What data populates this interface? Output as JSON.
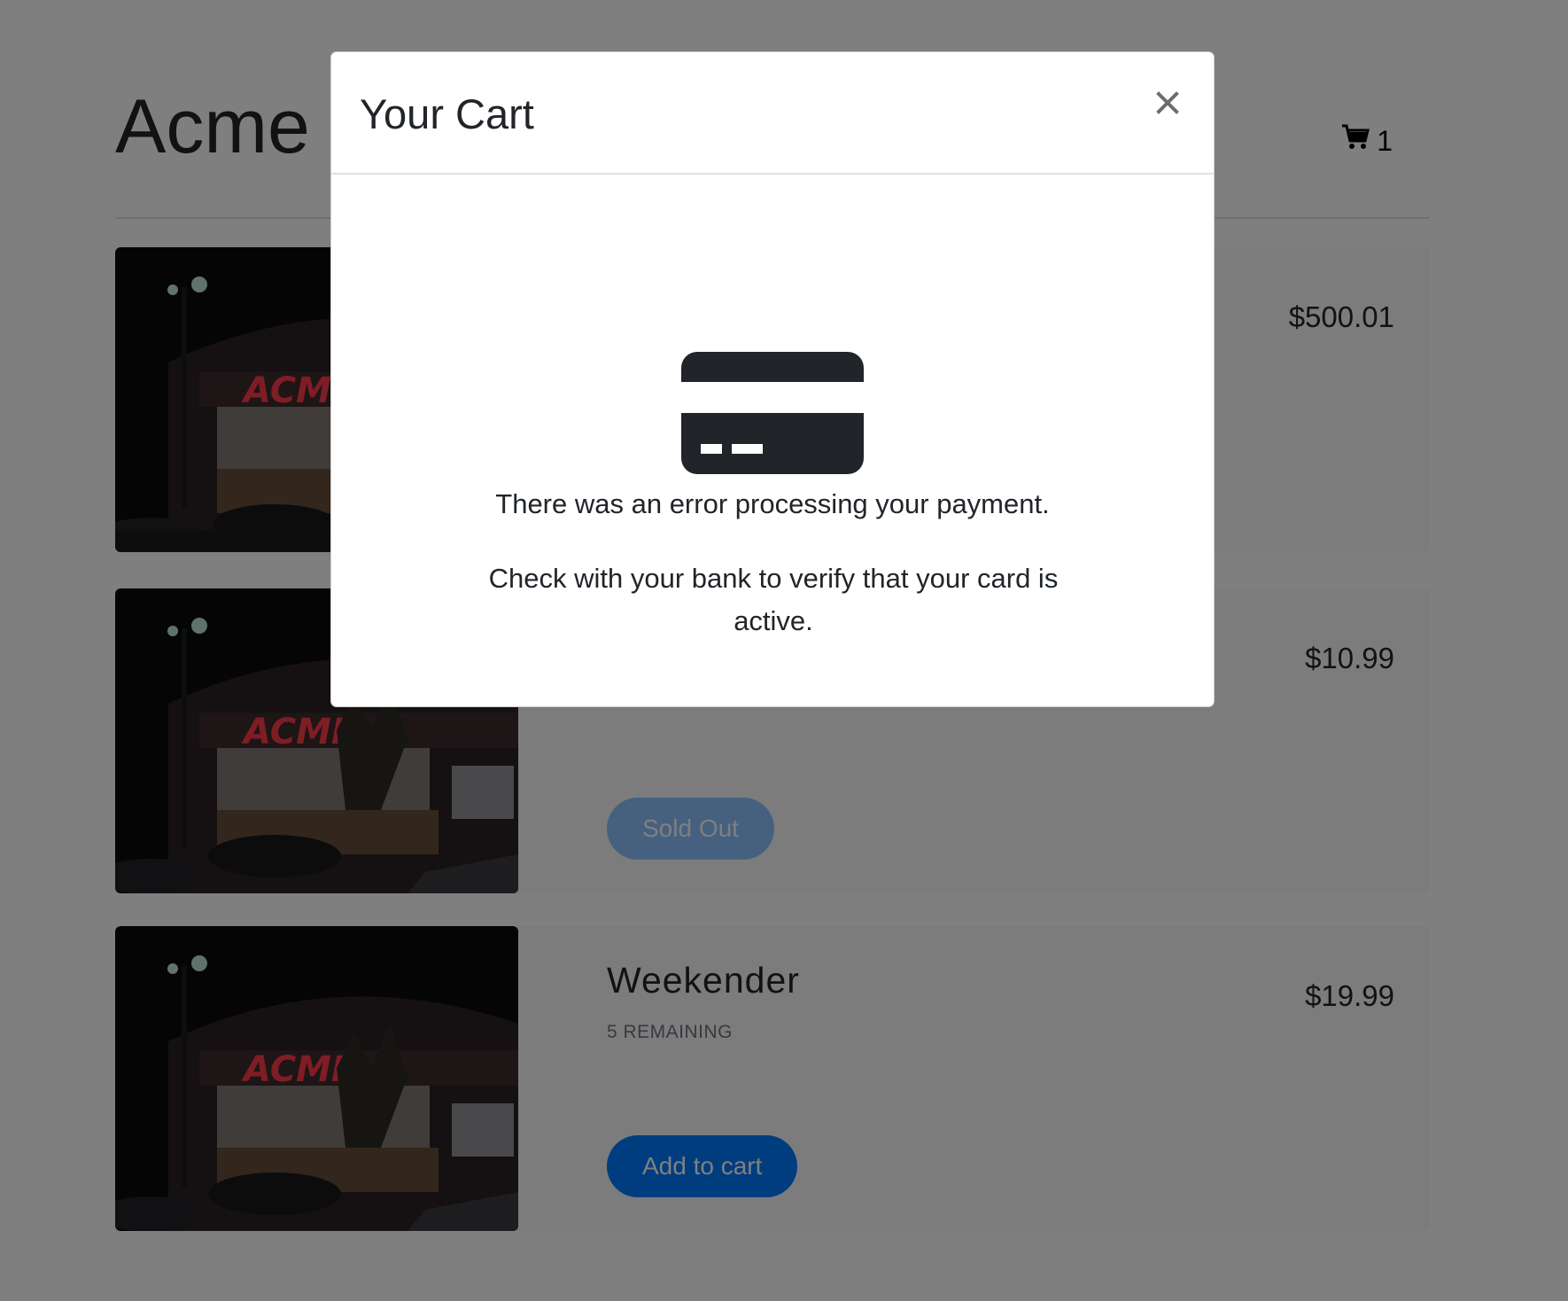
{
  "site": {
    "title": "Acme Store",
    "cart_count": "1"
  },
  "products": [
    {
      "name": "",
      "remaining": "",
      "price": "$500.01",
      "button_label": ""
    },
    {
      "name": "",
      "remaining": "",
      "price": "$10.99",
      "button_label": "Sold Out"
    },
    {
      "name": "Weekender",
      "remaining": "5 REMAINING",
      "price": "$19.99",
      "button_label": "Add to cart"
    }
  ],
  "modal": {
    "title": "Your Cart",
    "close_icon": "close-icon",
    "error_icon": "credit-card-icon",
    "error_message": "There was an error processing your payment.",
    "error_hint": "Check with your bank to verify that your card is active."
  },
  "colors": {
    "primary_button": "#007bff",
    "disabled_button": "#80bdff",
    "backdrop": "rgba(0,0,0,0.5)",
    "card_icon": "#212529"
  }
}
